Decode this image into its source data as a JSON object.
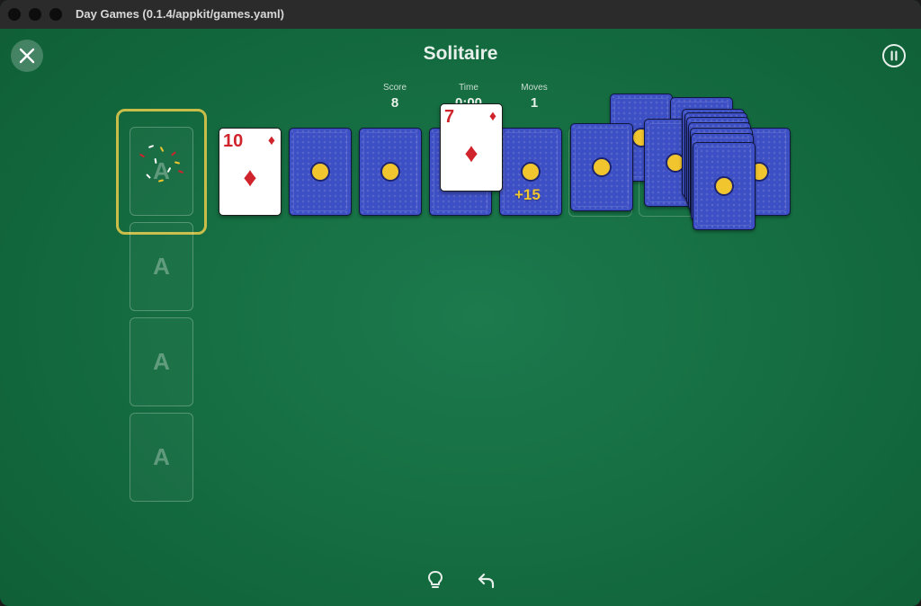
{
  "window": {
    "title": "Day Games (0.1.4/appkit/games.yaml)"
  },
  "game": {
    "title": "Solitaire"
  },
  "stats": {
    "score": {
      "label": "Score",
      "value": "8"
    },
    "time": {
      "label": "Time",
      "value": "0:00"
    },
    "moves": {
      "label": "Moves",
      "value": "1"
    }
  },
  "foundations": [
    {
      "label": "A"
    },
    {
      "label": "A"
    },
    {
      "label": "A"
    },
    {
      "label": "A"
    }
  ],
  "cards": {
    "ten_diamonds": {
      "rank": "10",
      "suit": "♦"
    },
    "seven_diamonds": {
      "rank": "7",
      "suit": "♦"
    }
  },
  "score_popup": "+15",
  "icons": {
    "close": "close-icon",
    "pause": "pause-icon",
    "hint": "lightbulb-icon",
    "undo": "undo-icon"
  },
  "colors": {
    "felt": "#1c7a4d",
    "card_back": "#3d4fc4",
    "coin": "#f1c52e",
    "highlight": "#c9bd4a",
    "red_suit": "#d0242c"
  }
}
